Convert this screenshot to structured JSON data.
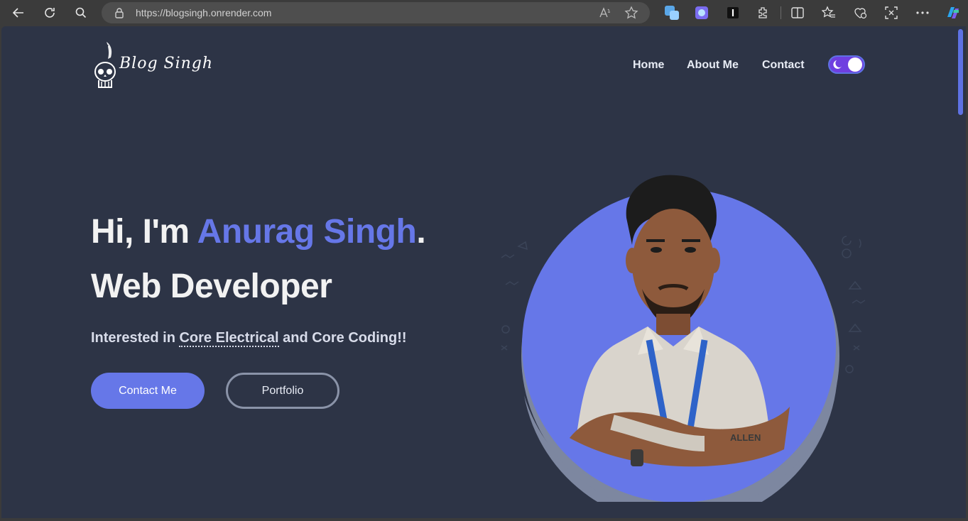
{
  "browser": {
    "url": "https://blogsingh.onrender.com",
    "icons": [
      "back-icon",
      "refresh-icon",
      "search-icon",
      "lock-icon",
      "read-aloud-icon",
      "favorite-star-icon",
      "extension-icon",
      "split-screen-icon",
      "favorites-icon",
      "browser-essentials-icon",
      "screenshot-icon",
      "more-icon",
      "copilot-icon"
    ]
  },
  "site": {
    "logo_text": "Blog Singh",
    "nav": {
      "home": "Home",
      "about": "About Me",
      "contact": "Contact"
    },
    "theme_toggle": "dark"
  },
  "hero": {
    "greeting": "Hi, I'm ",
    "name": "Anurag Singh",
    "period": ".",
    "role": "Web Developer",
    "subtitle_pre": "Interested in ",
    "subtitle_highlight": "Core Electrical",
    "subtitle_post": " and Core Coding!!",
    "buttons": {
      "contact": "Contact Me",
      "portfolio": "Portfolio"
    }
  },
  "colors": {
    "page_bg": "#2d3446",
    "accent": "#6677e8",
    "toggle": "#6f3fe0"
  }
}
